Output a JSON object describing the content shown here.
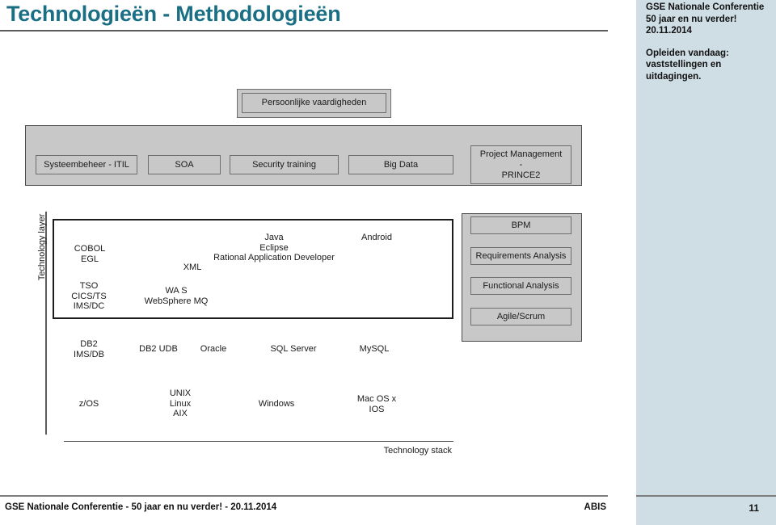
{
  "slide": {
    "title": "Technologieën - Methodologieën"
  },
  "sidebar": {
    "line1": "GSE Nationale Conferentie",
    "line2": "50 jaar en nu verder!",
    "line3": "20.11.2014",
    "line4": "Opleiden vandaag:",
    "line5": "vaststellingen en uitdagingen.",
    "page_number": "11"
  },
  "footer": {
    "left": "GSE Nationale Conferentie -  50 jaar en nu verder! - 20.11.2014",
    "right": "ABIS"
  },
  "diagram": {
    "skills_box": "Persoonlijke vaardigheden",
    "top_band": [
      {
        "label": "Systeembeheer - ITIL"
      },
      {
        "label": "SOA"
      },
      {
        "label": "Security training"
      },
      {
        "label": "Big Data"
      },
      {
        "label": "Project Management\n-\nPRINCE2"
      }
    ],
    "methodology_band": [
      {
        "label": "BPM"
      },
      {
        "label": "Requirements Analysis"
      },
      {
        "label": "Functional Analysis"
      },
      {
        "label": "Agile/Scrum"
      }
    ],
    "axis_label": "Technology layer",
    "stack_label": "Technology stack",
    "technology_layer": [
      {
        "label": "COBOL\nEGL"
      },
      {
        "label": "XML"
      },
      {
        "label": "Java\nEclipse\nRational Application Developer"
      },
      {
        "label": "Android"
      },
      {
        "label": "TSO\nCICS/TS\nIMS/DC"
      },
      {
        "label": "WA S\nWebSphere MQ"
      }
    ],
    "database_layer": [
      {
        "label": "DB2\nIMS/DB"
      },
      {
        "label": "DB2 UDB"
      },
      {
        "label": "Oracle"
      },
      {
        "label": "SQL Server"
      },
      {
        "label": "MySQL"
      }
    ],
    "os_layer": [
      {
        "label": "z/OS"
      },
      {
        "label": "UNIX\nLinux\nAIX"
      },
      {
        "label": "Windows"
      },
      {
        "label": "Mac OS x\nIOS"
      }
    ]
  },
  "colors": {
    "title": "#1a6f85",
    "sidebar_bg": "#cfdde4",
    "box_fill": "#c8c8c8",
    "rule": "#5b5b5b"
  }
}
